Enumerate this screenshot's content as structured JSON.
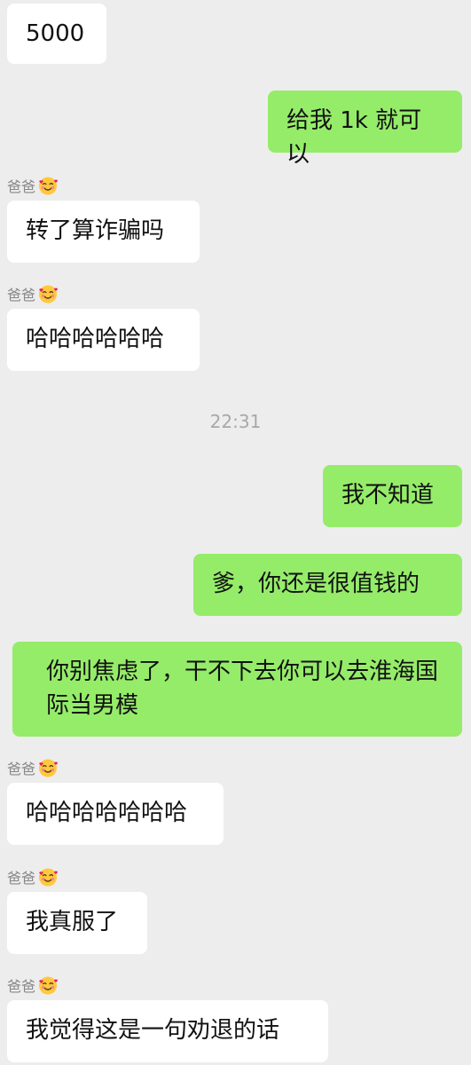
{
  "messages": {
    "m1": "5000",
    "m2": "给我 1k 就可以",
    "m3": "转了算诈骗吗",
    "m4": "哈哈哈哈哈哈",
    "m5": "我不知道",
    "m6": "爹，你还是很值钱的",
    "m7": "你别焦虑了，干不下去你可以去淮海国际当男模",
    "m8": "哈哈哈哈哈哈哈",
    "m9": "我真服了",
    "m10": "我觉得这是一句劝退的话"
  },
  "sender_name": "爸爸",
  "sender_icon": "smiling-face-with-hearts-icon",
  "timestamp": "22:31",
  "colors": {
    "background": "#ededed",
    "incoming_bubble": "#ffffff",
    "outgoing_bubble": "#95ec69",
    "meta_text": "#888888"
  }
}
